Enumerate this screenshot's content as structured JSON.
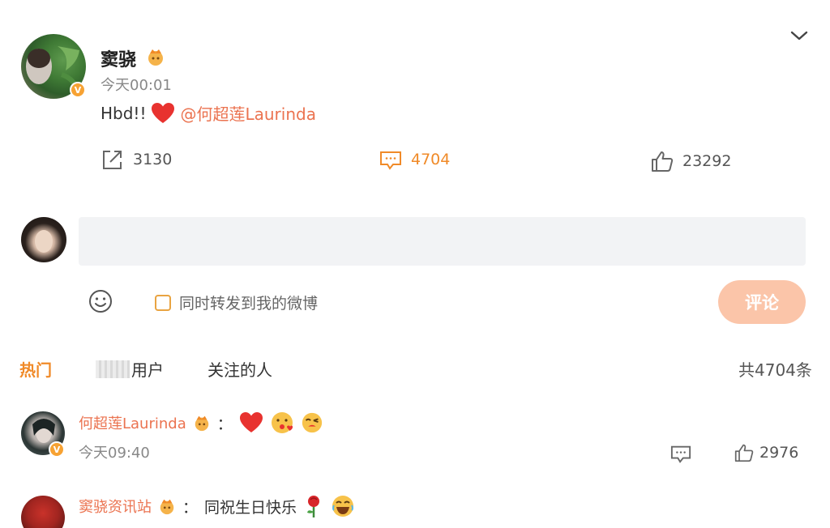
{
  "post": {
    "author": "窦骁",
    "time": "今天00:01",
    "text": "Hbd!!",
    "mention": "@何超莲Laurinda",
    "reposts": "3130",
    "comments": "4704",
    "likes": "23292"
  },
  "composer": {
    "forward_label": "同时转发到我的微博",
    "submit_label": "评论"
  },
  "tabs": {
    "hot": "热门",
    "verified_partial": "用户",
    "following": "关注的人",
    "total": "共4704条"
  },
  "comments": [
    {
      "name": "何超莲Laurinda",
      "separator": "：",
      "time": "今天09:40",
      "likes": "2976"
    },
    {
      "name": "窦骁资讯站",
      "separator": "：",
      "text": "同祝生日快乐"
    }
  ],
  "colors": {
    "accent": "#f08a28",
    "mention": "#eb7350",
    "verified_badge": "#f7a233",
    "submit_disabled": "#fbc5a9"
  },
  "icons": [
    "chevron-down-icon",
    "repost-icon",
    "comment-icon",
    "like-icon",
    "emoji-icon",
    "heart-icon",
    "crown-badge-icon",
    "rose-icon",
    "laughing-emoji-icon"
  ]
}
